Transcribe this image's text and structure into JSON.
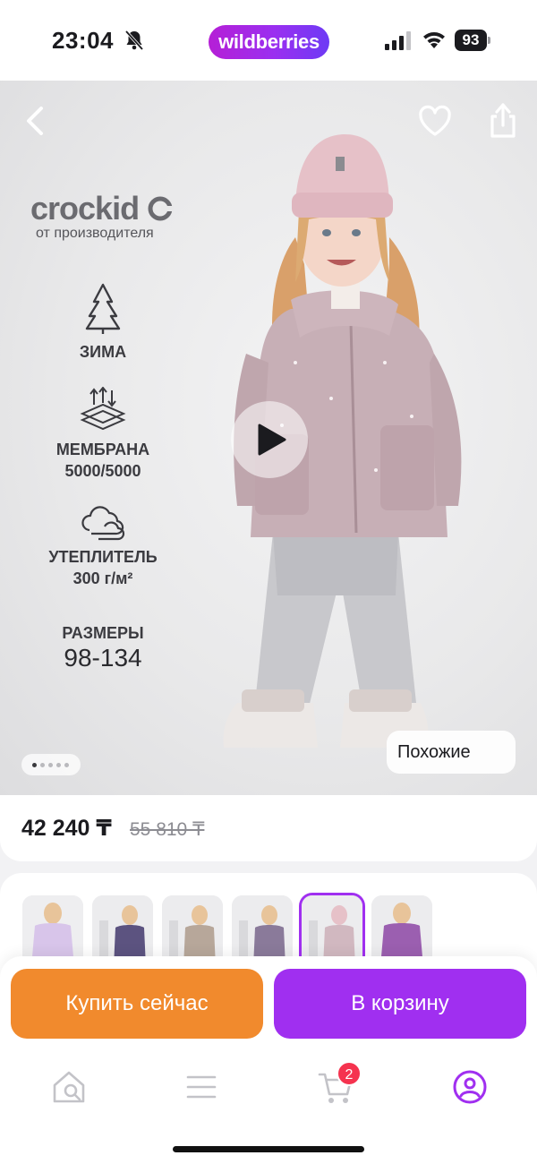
{
  "status_bar": {
    "time": "23:04",
    "brand": "wildberries",
    "battery": "93",
    "icons": [
      "bell-muted-icon",
      "signal-icon",
      "wifi-icon",
      "battery-icon"
    ]
  },
  "hero": {
    "brand_logo": "crockid",
    "brand_subtitle": "от производителя",
    "features": [
      {
        "icon": "snowflake-tree-icon",
        "label": "ЗИМА"
      },
      {
        "icon": "membrane-icon",
        "label": "МЕМБРАНА",
        "value": "5000/5000"
      },
      {
        "icon": "cloud-icon",
        "label": "УТЕПЛИТЕЛЬ",
        "value": "300 г/м²"
      },
      {
        "label": "РАЗМЕРЫ",
        "value": "98-134"
      }
    ],
    "similar_label": "Похожие",
    "carousel_dots": 5,
    "carousel_active": 0
  },
  "price": {
    "current": "42 240 ₸",
    "old": "55 810 ₸"
  },
  "variants": {
    "count": 6,
    "selected_index": 4,
    "colors": [
      "#d8c5ea",
      "#5c5380",
      "#b7a79a",
      "#8a7a9a",
      "#d1b8c0",
      "#9b5fb0"
    ]
  },
  "actions": {
    "buy_now": "Купить сейчас",
    "add_to_cart": "В корзину"
  },
  "tab_bar": {
    "items": [
      "home-search-icon",
      "menu-icon",
      "cart-icon",
      "profile-icon"
    ],
    "cart_badge": "2",
    "active_color": "#a02ff0",
    "inactive_color": "#c3c3c8"
  }
}
